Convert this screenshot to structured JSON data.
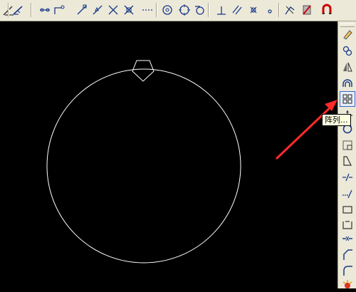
{
  "top_toolbar": {
    "buttons": [
      {
        "name": "hatch-edit-icon"
      },
      {
        "name": "dimension-icon"
      },
      {
        "name": "linear-dim-icon"
      },
      {
        "name": "ordinate-dim-icon"
      },
      {
        "name": "snap-endpoint-icon"
      },
      {
        "name": "snap-midpoint-icon"
      },
      {
        "name": "snap-intersection-icon"
      },
      {
        "name": "snap-apparent-intersection-icon"
      },
      {
        "name": "snap-extension-icon"
      },
      {
        "name": "snap-center-icon"
      },
      {
        "name": "snap-quadrant-icon"
      },
      {
        "name": "snap-tangent-icon"
      },
      {
        "name": "snap-perpendicular-icon"
      },
      {
        "name": "snap-parallel-icon"
      },
      {
        "name": "snap-node-icon"
      },
      {
        "name": "snap-nearest-icon"
      },
      {
        "name": "snap-none-icon"
      },
      {
        "name": "snap-settings-icon"
      }
    ]
  },
  "right_toolbar": {
    "buttons": [
      {
        "name": "erase-icon"
      },
      {
        "name": "copy-icon"
      },
      {
        "name": "mirror-icon"
      },
      {
        "name": "offset-icon"
      },
      {
        "name": "array-icon",
        "tooltip": "阵列..."
      },
      {
        "name": "move-icon"
      },
      {
        "name": "rotate-icon"
      },
      {
        "name": "scale-icon"
      },
      {
        "name": "stretch-icon"
      },
      {
        "name": "trim-icon"
      },
      {
        "name": "extend-icon"
      },
      {
        "name": "break-at-point-icon"
      },
      {
        "name": "break-icon"
      },
      {
        "name": "join-icon"
      },
      {
        "name": "chamfer-icon"
      },
      {
        "name": "fillet-icon"
      },
      {
        "name": "explode-icon"
      }
    ]
  },
  "tooltip": {
    "text": "阵列..."
  },
  "colors": {
    "toolbar_bg": "#ece9d8",
    "canvas_bg": "#000000",
    "drawing_stroke": "#ffffff",
    "arrow": "#ff2a2a"
  }
}
